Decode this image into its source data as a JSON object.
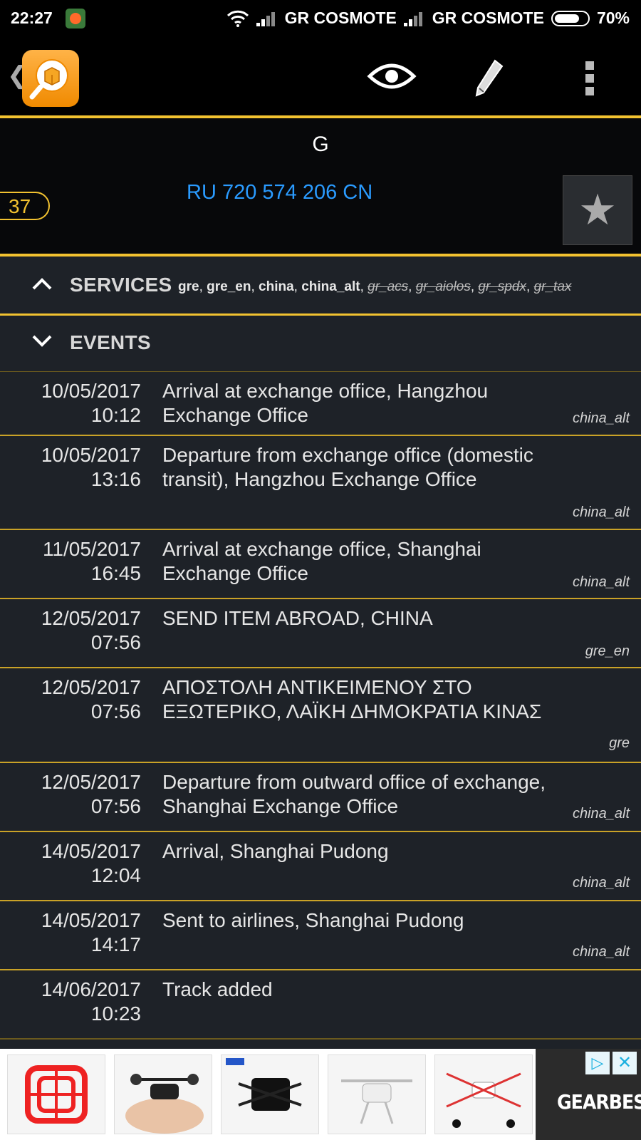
{
  "status_bar": {
    "time": "22:27",
    "carrier1": "GR COSMOTE",
    "carrier2": "GR COSMOTE",
    "battery": "70%"
  },
  "header": {
    "title": "G",
    "days_badge": "37",
    "tracking_number": "RU 720 574 206 CN"
  },
  "services": {
    "label": "SERVICES",
    "active": [
      "gre",
      "gre_en",
      "china",
      "china_alt"
    ],
    "inactive": [
      "gr_acs",
      "gr_aiolos",
      "gr_spdx",
      "gr_tax"
    ]
  },
  "events_section": {
    "label": "EVENTS"
  },
  "events": [
    {
      "date": "10/05/2017",
      "time": "10:12",
      "desc": "Arrival at exchange office, Hangzhou Exchange Office",
      "source": "china_alt"
    },
    {
      "date": "10/05/2017",
      "time": "13:16",
      "desc": "Departure from exchange office (domestic transit), Hangzhou Exchange Office",
      "source": "china_alt"
    },
    {
      "date": "11/05/2017",
      "time": "16:45",
      "desc": "Arrival at exchange office, Shanghai Exchange Office",
      "source": "china_alt"
    },
    {
      "date": "12/05/2017",
      "time": "07:56",
      "desc": "SEND ITEM ABROAD, CHINA",
      "source": "gre_en"
    },
    {
      "date": "12/05/2017",
      "time": "07:56",
      "desc": "ΑΠΟΣΤΟΛΗ ΑΝΤΙΚΕΙΜΕΝΟΥ ΣΤΟ ΕΞΩΤΕΡΙΚΟ, ΛΑΪΚΗ ΔΗΜΟΚΡΑΤΙΑ ΚΙΝΑΣ",
      "source": "gre"
    },
    {
      "date": "12/05/2017",
      "time": "07:56",
      "desc": "Departure from outward office of exchange, Shanghai Exchange Office",
      "source": "china_alt"
    },
    {
      "date": "14/05/2017",
      "time": "12:04",
      "desc": "Arrival, Shanghai Pudong",
      "source": "china_alt"
    },
    {
      "date": "14/05/2017",
      "time": "14:17",
      "desc": "Sent to airlines, Shanghai Pudong",
      "source": "china_alt"
    },
    {
      "date": "14/06/2017",
      "time": "10:23",
      "desc": "Track added",
      "source": ""
    }
  ],
  "ad": {
    "brand": "GEARBEST",
    "products": [
      "red-drone",
      "black-mini-drone",
      "black-selfie-drone",
      "white-camera-drone",
      "white-quadcopter"
    ]
  },
  "icons": {
    "back": "back-chevron-icon",
    "logo": "app-logo-icon",
    "eye": "eye-icon",
    "edit": "pencil-icon",
    "more": "more-vert-icon",
    "favorite": "star-icon"
  },
  "colors": {
    "accent": "#f2c230",
    "link": "#2a9bff",
    "background": "#1e2228",
    "header_bg": "#07080a"
  }
}
